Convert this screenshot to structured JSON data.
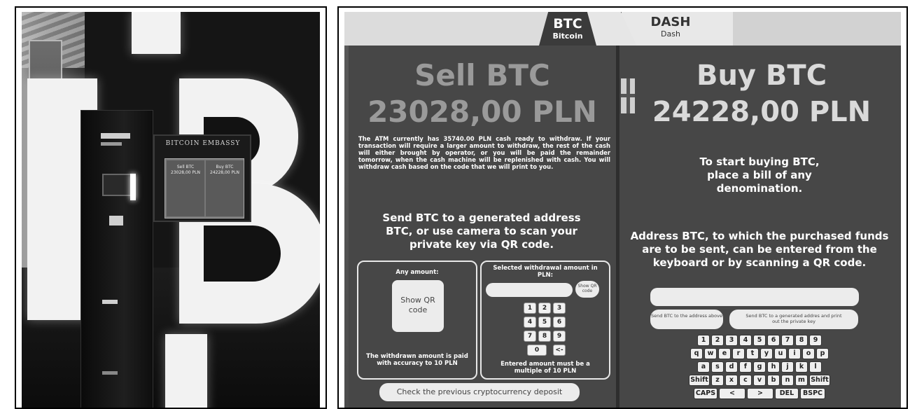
{
  "left_photo": {
    "atm_logo_text": "BITCOIN EMBASSY",
    "screen_sell": "Sell BTC",
    "screen_sell_price": "23028,00 PLN",
    "screen_buy": "Buy BTC",
    "screen_buy_price": "24228,00 PLN"
  },
  "tabs": {
    "btc_title": "BTC",
    "btc_sub": "Bitcoin",
    "dash_title": "DASH",
    "dash_sub": "Dash"
  },
  "sell": {
    "heading": "Sell BTC",
    "price": "23028,00 PLN",
    "notice": "The ATM currently has 35740.00 PLN cash ready to withdraw. If your transaction will require a larger amount to withdraw, the rest of the cash will either brought by operator, or you will be paid the remainder tomorrow, when the cash machine will be replenished with cash. You will withdraw cash based on the code that we will print to you.",
    "instructions": "Send BTC to a generated address BTC, or use camera to scan your private key via QR code.",
    "any_amount_label": "Any amount:",
    "show_qr_label": "Show QR code",
    "accuracy_note": "The withdrawn amount is paid with accuracy to 10 PLN",
    "selected_amount_label": "Selected withdrawal amount in PLN:",
    "show_code_small": "Show QR code",
    "keypad": [
      "1",
      "2",
      "3",
      "4",
      "5",
      "6",
      "7",
      "8",
      "9",
      "0",
      "<-"
    ],
    "multiple_note": "Entered amount must be a multiple of 10 PLN",
    "deposit_button": "Check the previous cryptocurrency deposit"
  },
  "buy": {
    "heading": "Buy BTC",
    "price": "24228,00 PLN",
    "start_text": "To start buying BTC, place a bill of any denomination.",
    "address_text": "Address BTC, to which the purchased funds are to be sent, can be entered from the keyboard or by scanning a QR code.",
    "send_button": "Send BTC to the address above",
    "generate_button": "Send BTC to a generated addres and print out the private key",
    "keyboard_rows": [
      [
        "1",
        "2",
        "3",
        "4",
        "5",
        "6",
        "7",
        "8",
        "9"
      ],
      [
        "q",
        "w",
        "e",
        "r",
        "t",
        "y",
        "u",
        "i",
        "o",
        "p"
      ],
      [
        "a",
        "s",
        "d",
        "f",
        "g",
        "h",
        "j",
        "k",
        "l"
      ],
      [
        "Shift",
        "z",
        "x",
        "c",
        "v",
        "b",
        "n",
        "m",
        "Shift"
      ],
      [
        "CAPS",
        "<",
        ">",
        "DEL",
        "BSPC"
      ]
    ]
  }
}
